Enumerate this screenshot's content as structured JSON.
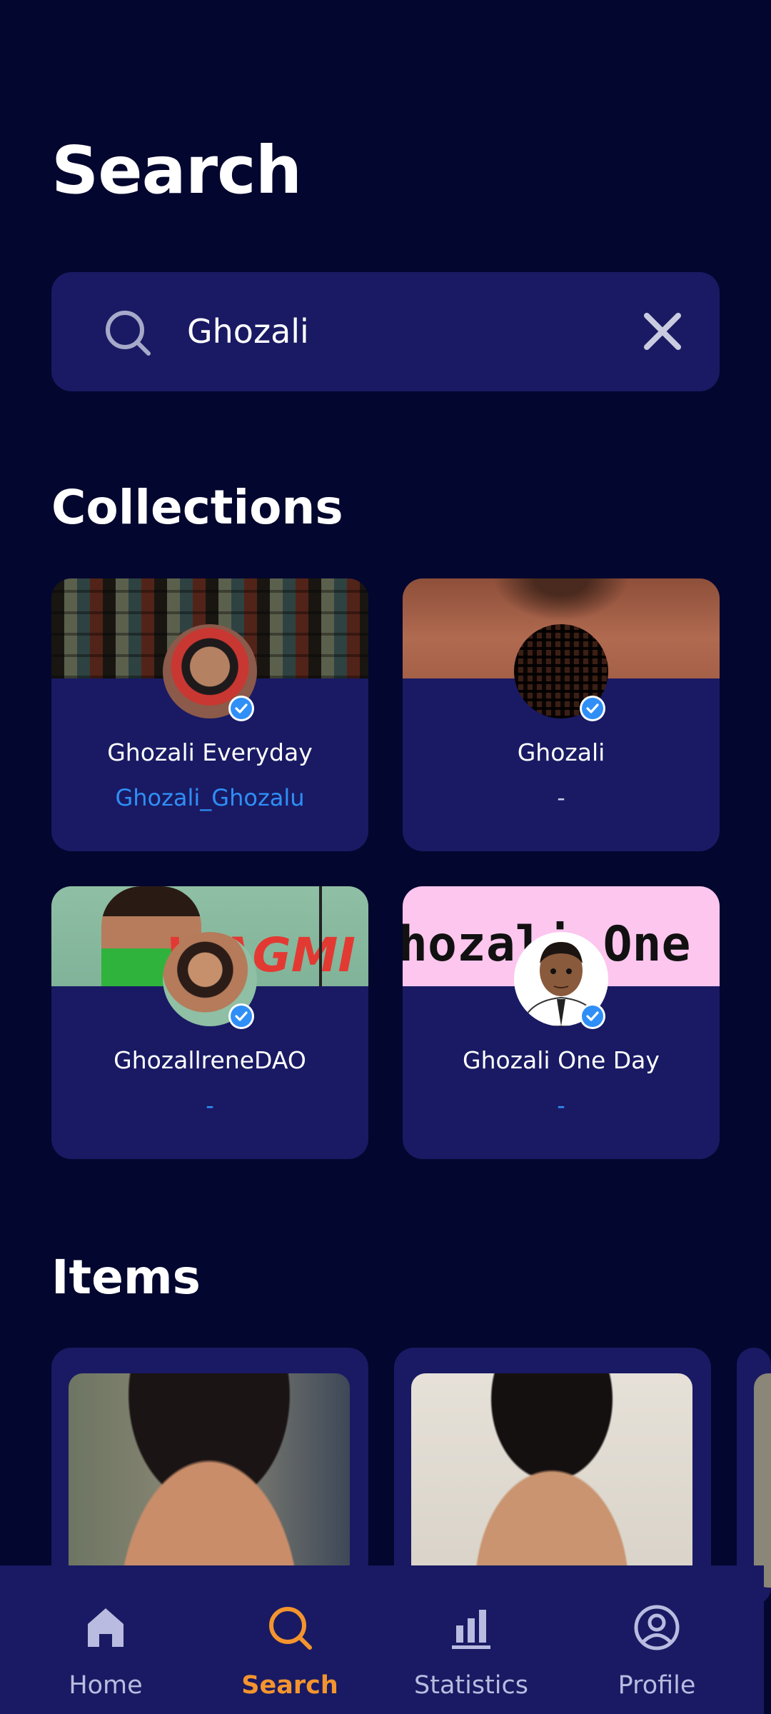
{
  "page": {
    "title": "Search"
  },
  "search": {
    "value": "Ghozali",
    "placeholder": ""
  },
  "colors": {
    "background": "#03062e",
    "card": "#191a63",
    "accent": "#f4942e",
    "link": "#2f8ff7",
    "verified": "#2f8ff7"
  },
  "collections": {
    "title": "Collections",
    "cards": [
      {
        "name": "Ghozali Everyday",
        "subtitle": "Ghozali_Ghozalu"
      },
      {
        "name": "Ghozali",
        "subtitle": "-"
      },
      {
        "name": "GhozallreneDAO",
        "subtitle": "-",
        "banner_text": "WAGMI"
      },
      {
        "name": "Ghozali One Day",
        "subtitle": "-",
        "banner_text": "hozali One Da"
      }
    ]
  },
  "items": {
    "title": "Items"
  },
  "nav": {
    "items": [
      {
        "label": "Home",
        "icon": "home-icon"
      },
      {
        "label": "Search",
        "icon": "search-icon",
        "active": true
      },
      {
        "label": "Statistics",
        "icon": "bar-chart-icon"
      },
      {
        "label": "Profile",
        "icon": "user-circle-icon"
      }
    ]
  }
}
